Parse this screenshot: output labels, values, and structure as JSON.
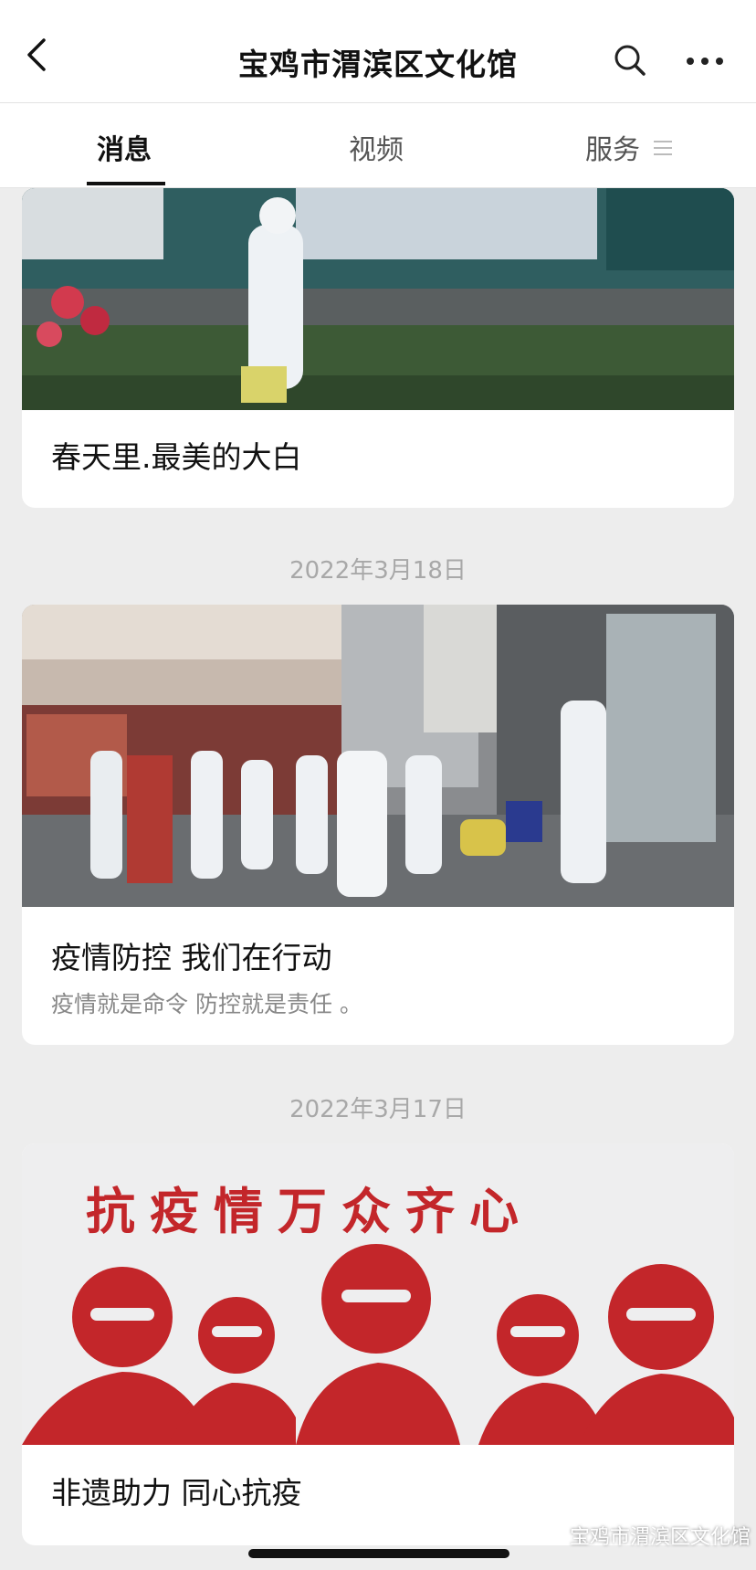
{
  "header": {
    "title": "宝鸡市渭滨区文化馆",
    "back_icon": "chevron-left-icon",
    "search_icon": "search-icon",
    "more_icon": "more-dots-icon"
  },
  "tabs": [
    {
      "label": "消息",
      "active": true
    },
    {
      "label": "视频",
      "active": false
    },
    {
      "label": "服务",
      "active": false
    }
  ],
  "feed": {
    "items": [
      {
        "headline": "春天里.最美的大白",
        "subtitle": ""
      },
      {
        "date": "2022年3月18日",
        "headline": "疫情防控 我们在行动",
        "subtitle": "疫情就是命令 防控就是责任 。"
      },
      {
        "date": "2022年3月17日",
        "headline": "非遗助力  同心抗疫",
        "subtitle": "",
        "image_caption": "抗疫情万众齐心"
      }
    ]
  },
  "watermark": {
    "text": "宝鸡市渭滨区文化馆",
    "icon": "wechat-icon"
  },
  "colors": {
    "background": "#ededed",
    "accent": "#111111",
    "papercut_red": "#c3262a"
  }
}
